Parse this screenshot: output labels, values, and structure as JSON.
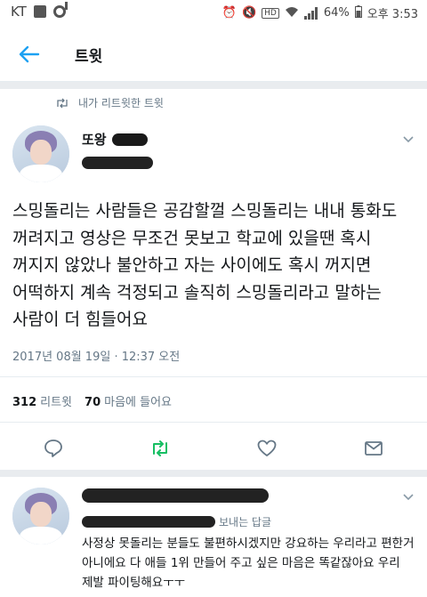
{
  "status_bar": {
    "carrier": "KT",
    "battery": "64%",
    "time": "오후 3:53",
    "hd": "HD"
  },
  "header": {
    "title": "트윗"
  },
  "tweet": {
    "retweet_context": "내가 리트윗한 트윗",
    "author_name_partial": "또왕",
    "text": "스밍돌리는 사람들은 공감할껄 스밍돌리는 내내 통화도\n꺼려지고 영상은 무조건 못보고 학교에 있을땐 혹시\n꺼지지 않았나 불안하고 자는 사이에도 혹시 꺼지면\n어떡하지 계속 걱정되고 솔직히 스밍돌리라고 말하는\n사람이 더 힘들어요",
    "timestamp": "2017년 08월 19일 · 12:37 오전",
    "retweets_count": "312",
    "retweets_label": "리트윗",
    "likes_count": "70",
    "likes_label": "마음에 들어요"
  },
  "reply": {
    "meta_suffix": "보내는 답글",
    "text": "사정상 못돌리는 분들도 불편하시겠지만 강요하는 우리라고 편한거\n아니에요 다 애들 1위 만들어 주고 싶은 마음은 똑같잖아요 우리\n제발 파이팅해요ㅜㅜ"
  },
  "colors": {
    "accent": "#1da1f2",
    "retweet_green": "#17bf63",
    "muted": "#657786"
  }
}
